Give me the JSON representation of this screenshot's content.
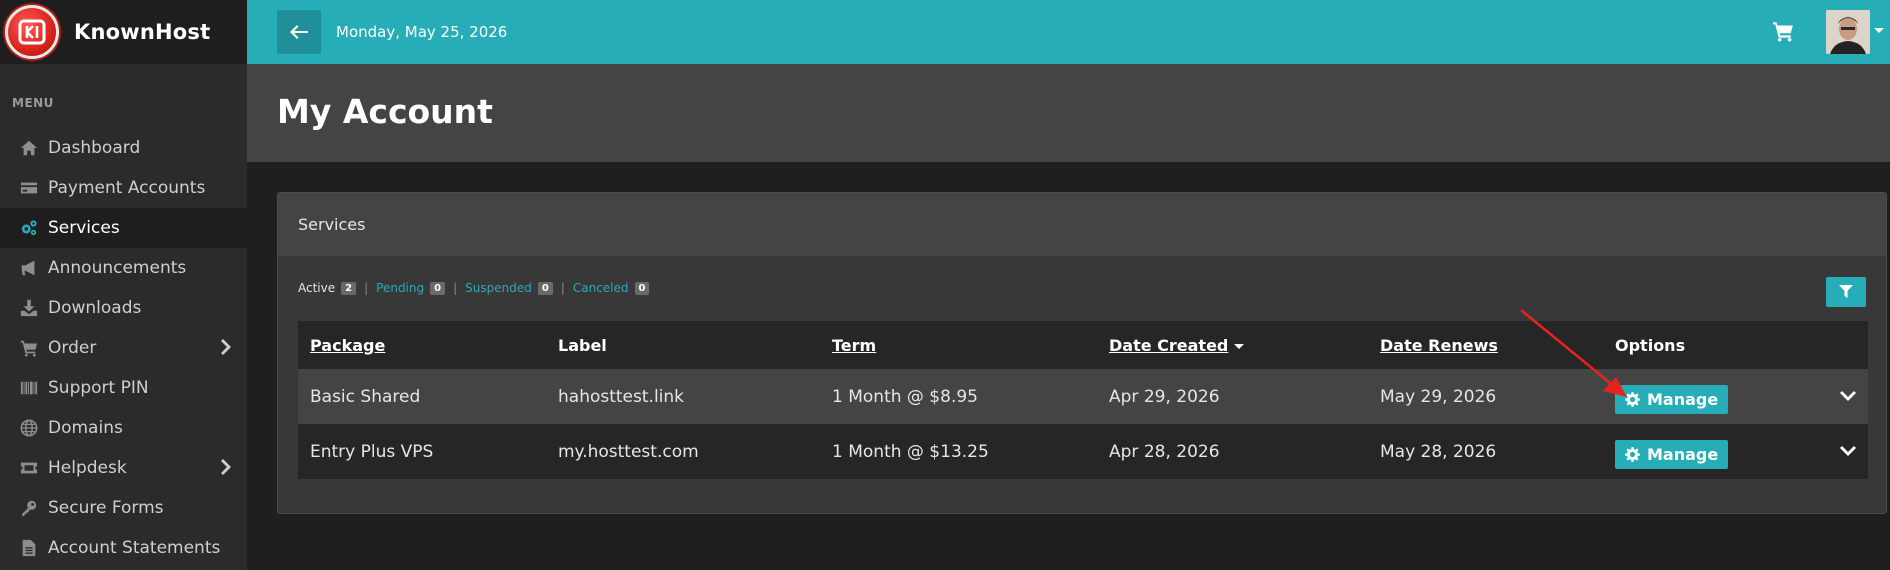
{
  "brand": {
    "name": "KnownHost"
  },
  "sidebar": {
    "menu_header": "MENU",
    "items": [
      {
        "label": "Dashboard",
        "icon": "home-icon"
      },
      {
        "label": "Payment Accounts",
        "icon": "credit-card-icon"
      },
      {
        "label": "Services",
        "icon": "cogs-icon",
        "active": true
      },
      {
        "label": "Announcements",
        "icon": "megaphone-icon"
      },
      {
        "label": "Downloads",
        "icon": "download-icon"
      },
      {
        "label": "Order",
        "icon": "cart-icon",
        "has_submenu": true
      },
      {
        "label": "Support PIN",
        "icon": "barcode-icon"
      },
      {
        "label": "Domains",
        "icon": "globe-icon"
      },
      {
        "label": "Helpdesk",
        "icon": "ticket-icon",
        "has_submenu": true
      },
      {
        "label": "Secure Forms",
        "icon": "key-icon"
      },
      {
        "label": "Account Statements",
        "icon": "file-icon"
      }
    ]
  },
  "topbar": {
    "date": "Monday, May 25, 2026",
    "back_icon": "arrow-left-icon",
    "cart_icon": "cart-icon"
  },
  "page": {
    "title": "My Account"
  },
  "services": {
    "card_title": "Services",
    "filters": [
      {
        "label": "Active",
        "count": "2"
      },
      {
        "label": "Pending",
        "count": "0"
      },
      {
        "label": "Suspended",
        "count": "0"
      },
      {
        "label": "Canceled",
        "count": "0"
      }
    ],
    "columns": [
      "Package",
      "Label",
      "Term",
      "Date Created",
      "Date Renews",
      "Options"
    ],
    "rows": [
      {
        "package": "Basic Shared",
        "label": "hahosttest.link",
        "term": "1 Month @ $8.95",
        "created": "Apr 29, 2026",
        "renews": "May 29, 2026",
        "action": "Manage"
      },
      {
        "package": "Entry Plus VPS",
        "label": "my.hosttest.com",
        "term": "1 Month @ $13.25",
        "created": "Apr 28, 2026",
        "renews": "May 28, 2026",
        "action": "Manage"
      }
    ]
  },
  "colors": {
    "accent": "#27adb8",
    "sidebar_bg": "#2b2b2b",
    "page_bg": "#1f1f1f",
    "annotation_arrow": "#e8231c"
  }
}
